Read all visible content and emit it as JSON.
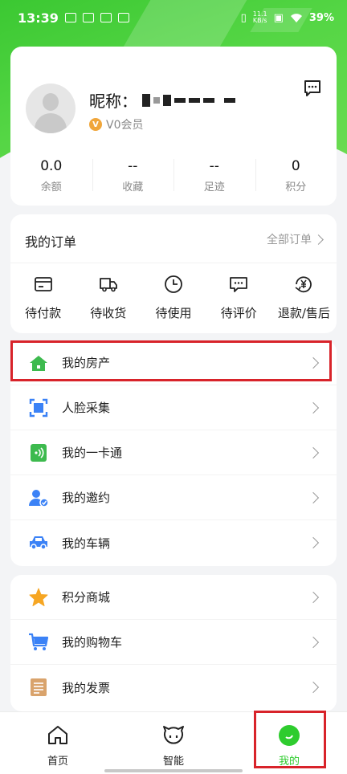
{
  "status_bar": {
    "time": "13:39",
    "speed_top": "11.1",
    "speed_unit": "KB/s",
    "battery": "39%"
  },
  "profile": {
    "nickname_label": "昵称：",
    "member_level": "V0会员",
    "vip_badge": "V"
  },
  "stats": [
    {
      "value": "0.0",
      "label": "余额"
    },
    {
      "value": "--",
      "label": "收藏"
    },
    {
      "value": "--",
      "label": "足迹"
    },
    {
      "value": "0",
      "label": "积分"
    }
  ],
  "orders": {
    "title": "我的订单",
    "all_label": "全部订单",
    "items": [
      {
        "label": "待付款",
        "icon": "card-icon"
      },
      {
        "label": "待收货",
        "icon": "truck-icon"
      },
      {
        "label": "待使用",
        "icon": "clock-icon"
      },
      {
        "label": "待评价",
        "icon": "comment-icon"
      },
      {
        "label": "退款/售后",
        "icon": "yuan-refund-icon"
      }
    ]
  },
  "menu1": [
    {
      "label": "我的房产",
      "icon": "house-icon"
    },
    {
      "label": "人脸采集",
      "icon": "face-scan-icon"
    },
    {
      "label": "我的一卡通",
      "icon": "card-wireless-icon"
    },
    {
      "label": "我的邀约",
      "icon": "user-invite-icon"
    },
    {
      "label": "我的车辆",
      "icon": "car-icon"
    }
  ],
  "menu2": [
    {
      "label": "积分商城",
      "icon": "star-icon"
    },
    {
      "label": "我的购物车",
      "icon": "cart-icon"
    },
    {
      "label": "我的发票",
      "icon": "invoice-icon"
    }
  ],
  "nav": [
    {
      "label": "首页",
      "icon": "home-nav-icon"
    },
    {
      "label": "智能",
      "icon": "robot-icon"
    },
    {
      "label": "我的",
      "icon": "profile-nav-icon"
    }
  ],
  "colors": {
    "brand_green": "#3bc832",
    "highlight_red": "#d8232a"
  }
}
